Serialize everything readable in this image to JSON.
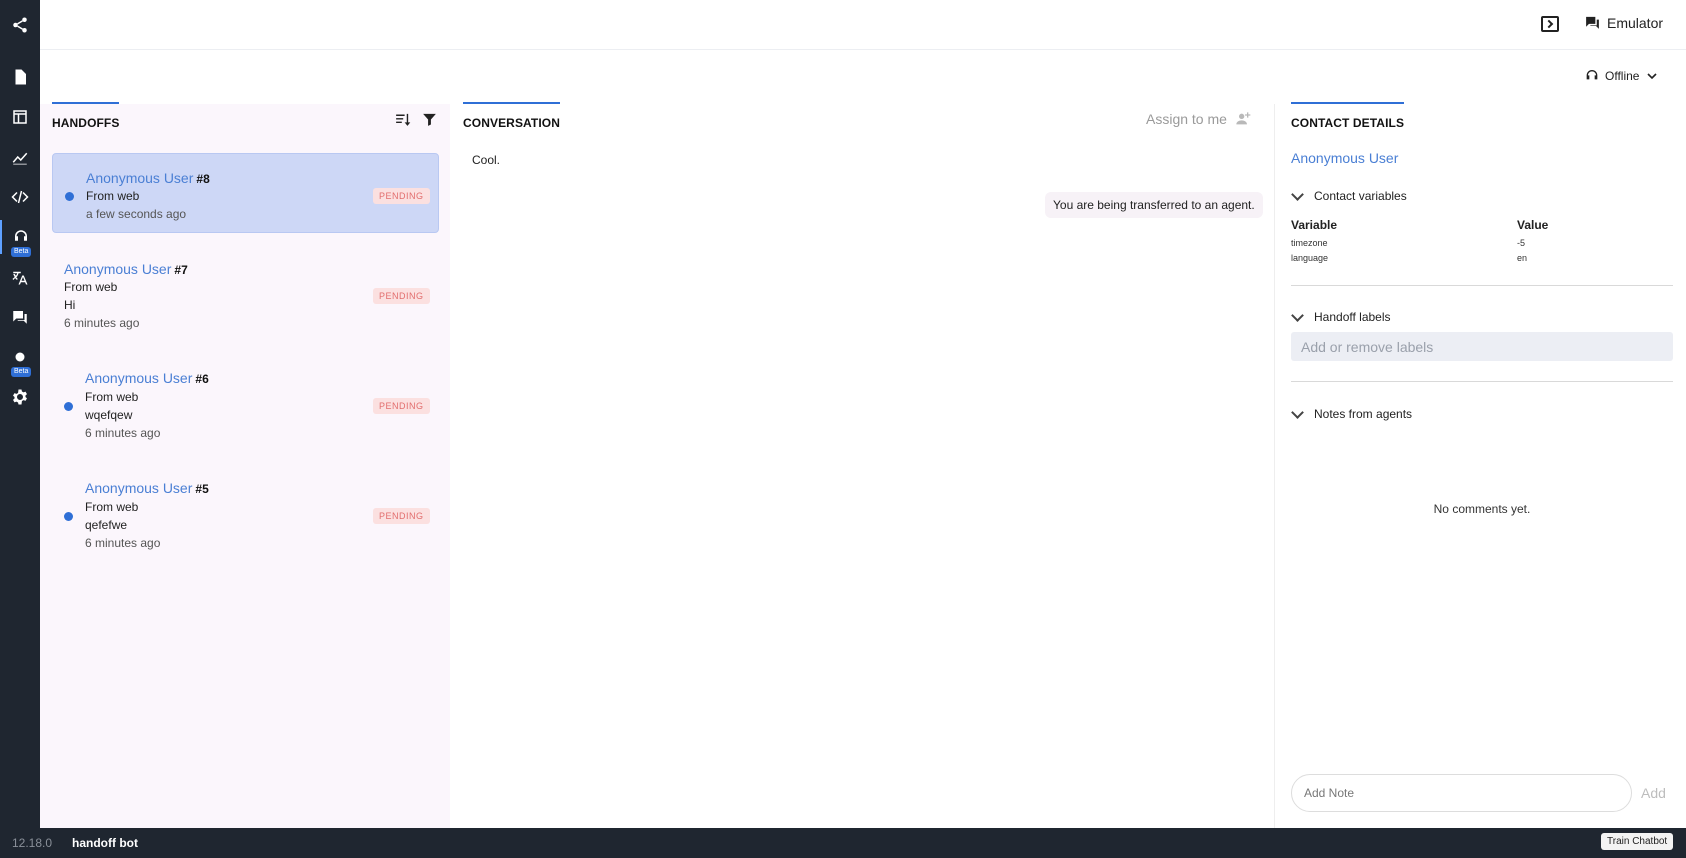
{
  "sidebar": {
    "items": [
      {
        "icon": "share-icon"
      },
      {
        "icon": "document-icon"
      },
      {
        "icon": "layout-icon"
      },
      {
        "icon": "analytics-icon"
      },
      {
        "icon": "code-icon"
      },
      {
        "icon": "headset-icon",
        "badge": "Beta",
        "active": true
      },
      {
        "icon": "translate-icon"
      },
      {
        "icon": "chat-icon"
      },
      {
        "icon": "dot-icon",
        "badge": "Beta"
      },
      {
        "icon": "gear-icon"
      }
    ]
  },
  "topbar": {
    "emulator_label": "Emulator"
  },
  "status": {
    "label": "Offline"
  },
  "handoffs": {
    "title": "HANDOFFS",
    "items": [
      {
        "name": "Anonymous User",
        "id": "#8",
        "source": "From web",
        "message": "",
        "time": "a few seconds ago",
        "status": "PENDING"
      },
      {
        "name": "Anonymous User",
        "id": "#7",
        "source": "From web",
        "message": "Hi",
        "time": "6 minutes ago",
        "status": "PENDING"
      },
      {
        "name": "Anonymous User",
        "id": "#6",
        "source": "From web",
        "message": "wqefqew",
        "time": "6 minutes ago",
        "status": "PENDING"
      },
      {
        "name": "Anonymous User",
        "id": "#5",
        "source": "From web",
        "message": "qefefwe",
        "time": "6 minutes ago",
        "status": "PENDING"
      }
    ]
  },
  "conversation": {
    "title": "CONVERSATION",
    "assign_label": "Assign to me",
    "messages": [
      {
        "from": "user",
        "text": "Cool."
      },
      {
        "from": "bot",
        "text": "You are being transferred to an agent."
      }
    ]
  },
  "contact": {
    "title": "CONTACT DETAILS",
    "name": "Anonymous User",
    "variables_label": "Contact variables",
    "var_header": "Variable",
    "value_header": "Value",
    "variables": [
      {
        "name": "timezone",
        "value": "-5"
      },
      {
        "name": "language",
        "value": "en"
      }
    ],
    "labels_label": "Handoff labels",
    "labels_placeholder": "Add or remove labels",
    "notes_label": "Notes from agents",
    "no_comments": "No comments yet.",
    "note_placeholder": "Add Note",
    "add_label": "Add"
  },
  "footer": {
    "version": "12.18.0",
    "bot_name": "handoff bot",
    "train_label": "Train Chatbot"
  },
  "colors": {
    "accent": "#2f6fd6",
    "link": "#4a7fd4",
    "rail_bg": "#1f2630",
    "pending_text": "#e26d6d",
    "pending_bg": "#fbe0e0",
    "selected_bg": "#cdd7f6"
  }
}
